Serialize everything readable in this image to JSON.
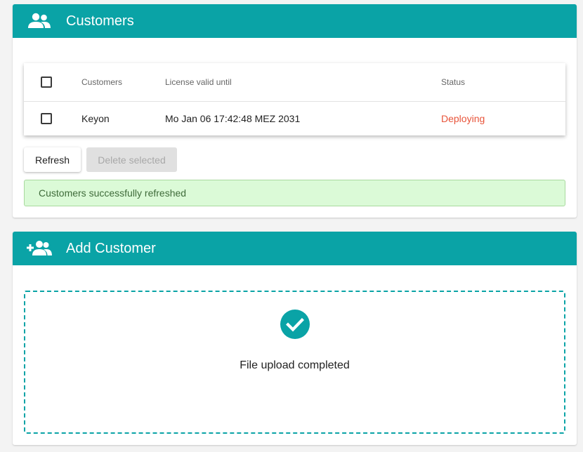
{
  "colors": {
    "accent": "#0aa3a6",
    "status_deploying": "#e8543a",
    "success_bg": "#dbfad7",
    "success_border": "#a8d99e"
  },
  "customers_panel": {
    "title": "Customers",
    "icon": "people-icon",
    "table": {
      "columns": [
        "Customers",
        "License valid until",
        "Status"
      ],
      "rows": [
        {
          "name": "Keyon",
          "license_valid_until": "Mo Jan 06 17:42:48 MEZ 2031",
          "status": "Deploying"
        }
      ]
    },
    "buttons": {
      "refresh": "Refresh",
      "delete_selected": "Delete selected"
    },
    "alert": "Customers successfully refreshed"
  },
  "add_customer_panel": {
    "title": "Add Customer",
    "icon": "add-person-icon",
    "dropzone": {
      "icon": "check-circle-icon",
      "message": "File upload completed"
    }
  }
}
